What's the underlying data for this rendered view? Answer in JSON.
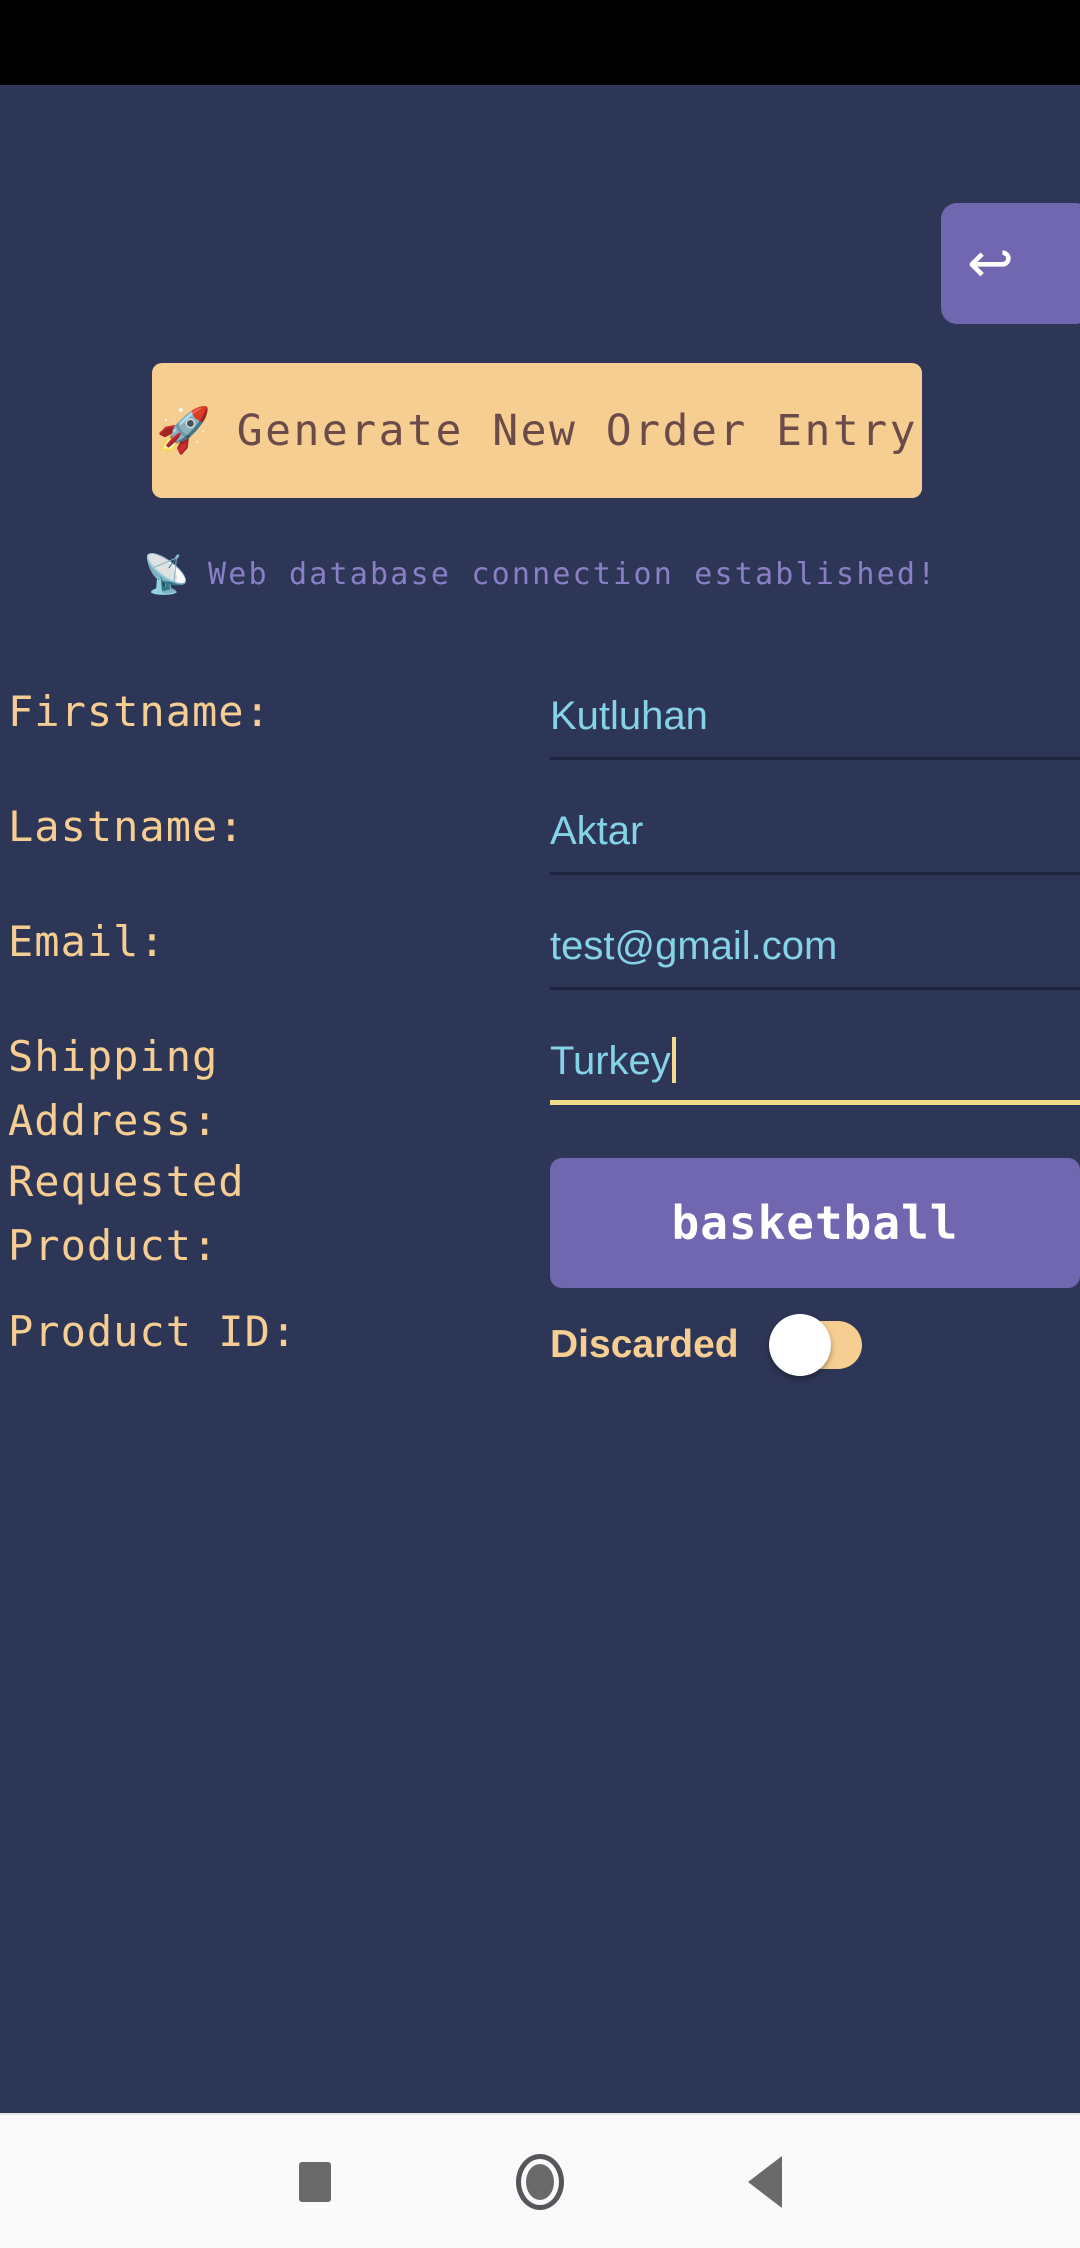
{
  "colors": {
    "background": "#2E3657",
    "accent_peach": "#F6CE92",
    "accent_purple": "#7166B0",
    "input_text": "#84D3E8",
    "status_text": "#8A7FC4",
    "focus_underline": "#F2DC8C",
    "button_text": "#6B4A4A"
  },
  "back_button": {
    "icon": "back-arrow-icon",
    "glyph": "↩"
  },
  "generate_button": {
    "icon": "rocket-icon",
    "emoji": "🚀",
    "label": "Generate New Order Entry"
  },
  "status_message": {
    "icon": "satellite-antenna-icon",
    "emoji": "📡",
    "text": "Web database connection established!"
  },
  "form": {
    "rows": [
      {
        "label": "Firstname:",
        "type": "text",
        "value": "Kutluhan",
        "placeholder": "",
        "focused": false
      },
      {
        "label": "Lastname:",
        "type": "text",
        "value": "Aktar",
        "placeholder": "",
        "focused": false
      },
      {
        "label": "Email:",
        "type": "text",
        "value": "test@gmail.com",
        "placeholder": "",
        "focused": false
      },
      {
        "label": "Shipping\nAddress:",
        "type": "text",
        "value": "Turkey",
        "placeholder": "",
        "focused": true
      },
      {
        "label": "Requested\nProduct:",
        "type": "dropdown",
        "value": "basketball"
      },
      {
        "label": "Product ID:",
        "type": "toggle",
        "toggle_label": "Discarded",
        "toggle_on": false
      }
    ]
  },
  "nav_bar": {
    "items": [
      {
        "name": "recents-square-icon"
      },
      {
        "name": "home-circle-icon"
      },
      {
        "name": "back-triangle-icon"
      }
    ]
  }
}
